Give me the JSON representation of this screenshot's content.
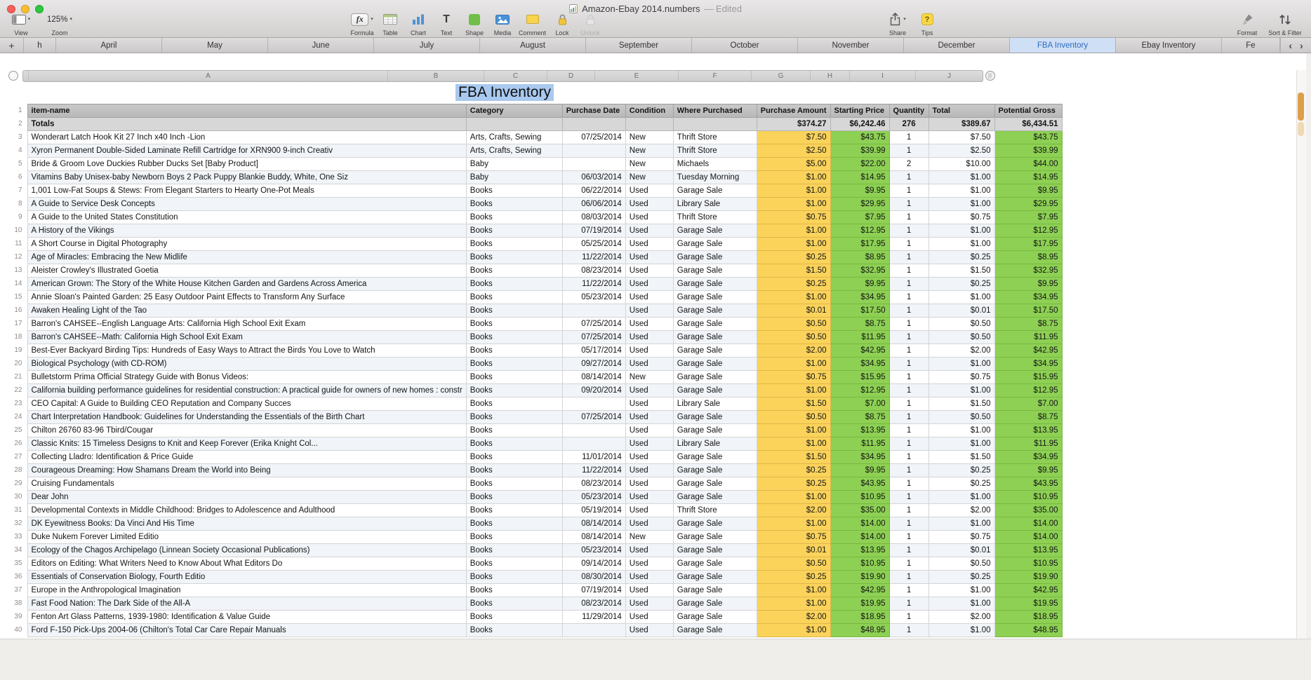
{
  "window": {
    "title": "Amazon-Ebay 2014.numbers",
    "title_suffix": " — Edited"
  },
  "toolbar": {
    "view": "View",
    "zoom": "Zoom",
    "zoom_value": "125%",
    "formula": "Formula",
    "table": "Table",
    "chart": "Chart",
    "text": "Text",
    "shape": "Shape",
    "media": "Media",
    "comment": "Comment",
    "lock": "Lock",
    "unlock": "Unlock",
    "share": "Share",
    "tips": "Tips",
    "format": "Format",
    "sort_filter": "Sort & Filter"
  },
  "tab_bar": {
    "add_tab": "+",
    "prev": "‹",
    "next": "›",
    "tabs": [
      {
        "label": "h",
        "selected": false,
        "partial": true
      },
      {
        "label": "April",
        "selected": false
      },
      {
        "label": "May",
        "selected": false
      },
      {
        "label": "June",
        "selected": false
      },
      {
        "label": "July",
        "selected": false
      },
      {
        "label": "August",
        "selected": false
      },
      {
        "label": "September",
        "selected": false
      },
      {
        "label": "October",
        "selected": false
      },
      {
        "label": "November",
        "selected": false
      },
      {
        "label": "December",
        "selected": false
      },
      {
        "label": "FBA Inventory",
        "selected": true
      },
      {
        "label": "Ebay Inventory",
        "selected": false
      },
      {
        "label": "Fe",
        "selected": false,
        "partial": true
      }
    ]
  },
  "sheet": {
    "title": "FBA Inventory",
    "column_letters": [
      "A",
      "B",
      "C",
      "D",
      "E",
      "F",
      "G",
      "H",
      "I",
      "J"
    ],
    "add_column_glyph": "||",
    "table": {
      "headers": [
        "item-name",
        "Category",
        "Purchase Date",
        "Condition",
        "Where Purchased",
        "Purchase Amount",
        "Starting Price",
        "Quantity",
        "Total",
        "Potential Gross"
      ],
      "totals": [
        "Totals",
        "",
        "",
        "",
        "",
        "$374.27",
        "$6,242.46",
        "276",
        "$389.67",
        "$6,434.51"
      ],
      "rows": [
        [
          "Wonderart Latch Hook Kit 27 Inch x40 Inch -Lion",
          "Arts, Crafts, Sewing",
          "07/25/2014",
          "New",
          "Thrift Store",
          "$7.50",
          "$43.75",
          "1",
          "$7.50",
          "$43.75"
        ],
        [
          "Xyron Permanent Double-Sided Laminate Refill Cartridge for XRN900 9-inch Creativ",
          "Arts, Crafts, Sewing",
          "",
          "New",
          "Thrift Store",
          "$2.50",
          "$39.99",
          "1",
          "$2.50",
          "$39.99"
        ],
        [
          "Bride & Groom Love Duckies Rubber Ducks Set [Baby Product]",
          "Baby",
          "",
          "New",
          "Michaels",
          "$5.00",
          "$22.00",
          "2",
          "$10.00",
          "$44.00"
        ],
        [
          "Vitamins Baby Unisex-baby Newborn Boys 2 Pack Puppy Blankie Buddy, White, One Siz",
          "Baby",
          "06/03/2014",
          "New",
          "Tuesday Morning",
          "$1.00",
          "$14.95",
          "1",
          "$1.00",
          "$14.95"
        ],
        [
          "1,001 Low-Fat Soups & Stews: From Elegant Starters to Hearty One-Pot Meals",
          "Books",
          "06/22/2014",
          "Used",
          "Garage Sale",
          "$1.00",
          "$9.95",
          "1",
          "$1.00",
          "$9.95"
        ],
        [
          "A Guide to Service Desk Concepts",
          "Books",
          "06/06/2014",
          "Used",
          "Library Sale",
          "$1.00",
          "$29.95",
          "1",
          "$1.00",
          "$29.95"
        ],
        [
          "A Guide to the United States Constitution",
          "Books",
          "08/03/2014",
          "Used",
          "Thrift Store",
          "$0.75",
          "$7.95",
          "1",
          "$0.75",
          "$7.95"
        ],
        [
          "A History of the Vikings",
          "Books",
          "07/19/2014",
          "Used",
          "Garage Sale",
          "$1.00",
          "$12.95",
          "1",
          "$1.00",
          "$12.95"
        ],
        [
          "A Short Course in Digital Photography",
          "Books",
          "05/25/2014",
          "Used",
          "Garage Sale",
          "$1.00",
          "$17.95",
          "1",
          "$1.00",
          "$17.95"
        ],
        [
          "Age of Miracles: Embracing the New Midlife",
          "Books",
          "11/22/2014",
          "Used",
          "Garage Sale",
          "$0.25",
          "$8.95",
          "1",
          "$0.25",
          "$8.95"
        ],
        [
          "Aleister Crowley's Illustrated Goetia",
          "Books",
          "08/23/2014",
          "Used",
          "Garage Sale",
          "$1.50",
          "$32.95",
          "1",
          "$1.50",
          "$32.95"
        ],
        [
          "American Grown: The Story of the White House Kitchen Garden and Gardens Across America",
          "Books",
          "11/22/2014",
          "Used",
          "Garage Sale",
          "$0.25",
          "$9.95",
          "1",
          "$0.25",
          "$9.95"
        ],
        [
          "Annie Sloan's Painted Garden: 25 Easy Outdoor Paint Effects to Transform Any Surface",
          "Books",
          "05/23/2014",
          "Used",
          "Garage Sale",
          "$1.00",
          "$34.95",
          "1",
          "$1.00",
          "$34.95"
        ],
        [
          "Awaken Healing Light of the Tao",
          "Books",
          "",
          "Used",
          "Garage Sale",
          "$0.01",
          "$17.50",
          "1",
          "$0.01",
          "$17.50"
        ],
        [
          "Barron's CAHSEE--English Language Arts: California High School Exit Exam",
          "Books",
          "07/25/2014",
          "Used",
          "Garage Sale",
          "$0.50",
          "$8.75",
          "1",
          "$0.50",
          "$8.75"
        ],
        [
          "Barron's CAHSEE--Math: California High School Exit Exam",
          "Books",
          "07/25/2014",
          "Used",
          "Garage Sale",
          "$0.50",
          "$11.95",
          "1",
          "$0.50",
          "$11.95"
        ],
        [
          "Best-Ever Backyard Birding Tips: Hundreds of Easy Ways to Attract the Birds You Love to Watch",
          "Books",
          "05/17/2014",
          "Used",
          "Garage Sale",
          "$2.00",
          "$42.95",
          "1",
          "$2.00",
          "$42.95"
        ],
        [
          "Biological Psychology (with CD-ROM)",
          "Books",
          "09/27/2014",
          "Used",
          "Garage Sale",
          "$1.00",
          "$34.95",
          "1",
          "$1.00",
          "$34.95"
        ],
        [
          "Bulletstorm Prima Official Strategy Guide with Bonus Videos:",
          "Books",
          "08/14/2014",
          "New",
          "Garage Sale",
          "$0.75",
          "$15.95",
          "1",
          "$0.75",
          "$15.95"
        ],
        [
          "California building performance guidelines for residential construction: A practical guide for owners of new homes : constr",
          "Books",
          "09/20/2014",
          "Used",
          "Garage Sale",
          "$1.00",
          "$12.95",
          "1",
          "$1.00",
          "$12.95"
        ],
        [
          "CEO Capital: A Guide to Building CEO Reputation and Company Succes",
          "Books",
          "",
          "Used",
          "Library Sale",
          "$1.50",
          "$7.00",
          "1",
          "$1.50",
          "$7.00"
        ],
        [
          "Chart Interpretation Handbook: Guidelines for Understanding the Essentials of the Birth Chart",
          "Books",
          "07/25/2014",
          "Used",
          "Garage Sale",
          "$0.50",
          "$8.75",
          "1",
          "$0.50",
          "$8.75"
        ],
        [
          "Chilton 26760 83-96 Tbird/Cougar",
          "Books",
          "",
          "Used",
          "Garage Sale",
          "$1.00",
          "$13.95",
          "1",
          "$1.00",
          "$13.95"
        ],
        [
          "Classic Knits: 15 Timeless Designs to Knit and Keep Forever (Erika Knight Col...",
          "Books",
          "",
          "Used",
          "Library Sale",
          "$1.00",
          "$11.95",
          "1",
          "$1.00",
          "$11.95"
        ],
        [
          "Collecting Lladro: Identification & Price Guide",
          "Books",
          "11/01/2014",
          "Used",
          "Garage Sale",
          "$1.50",
          "$34.95",
          "1",
          "$1.50",
          "$34.95"
        ],
        [
          "Courageous Dreaming: How Shamans Dream the World into Being",
          "Books",
          "11/22/2014",
          "Used",
          "Garage Sale",
          "$0.25",
          "$9.95",
          "1",
          "$0.25",
          "$9.95"
        ],
        [
          "Cruising Fundamentals",
          "Books",
          "08/23/2014",
          "Used",
          "Garage Sale",
          "$0.25",
          "$43.95",
          "1",
          "$0.25",
          "$43.95"
        ],
        [
          "Dear John",
          "Books",
          "05/23/2014",
          "Used",
          "Garage Sale",
          "$1.00",
          "$10.95",
          "1",
          "$1.00",
          "$10.95"
        ],
        [
          "Developmental Contexts in Middle Childhood: Bridges to Adolescence and Adulthood",
          "Books",
          "05/19/2014",
          "Used",
          "Thrift Store",
          "$2.00",
          "$35.00",
          "1",
          "$2.00",
          "$35.00"
        ],
        [
          "DK Eyewitness Books: Da Vinci And His Time",
          "Books",
          "08/14/2014",
          "Used",
          "Garage Sale",
          "$1.00",
          "$14.00",
          "1",
          "$1.00",
          "$14.00"
        ],
        [
          "Duke Nukem Forever Limited Editio",
          "Books",
          "08/14/2014",
          "New",
          "Garage Sale",
          "$0.75",
          "$14.00",
          "1",
          "$0.75",
          "$14.00"
        ],
        [
          "Ecology of the Chagos Archipelago (Linnean Society Occasional Publications)",
          "Books",
          "05/23/2014",
          "Used",
          "Garage Sale",
          "$0.01",
          "$13.95",
          "1",
          "$0.01",
          "$13.95"
        ],
        [
          "Editors on Editing: What Writers Need to Know About What Editors Do",
          "Books",
          "09/14/2014",
          "Used",
          "Garage Sale",
          "$0.50",
          "$10.95",
          "1",
          "$0.50",
          "$10.95"
        ],
        [
          "Essentials of Conservation Biology, Fourth Editio",
          "Books",
          "08/30/2014",
          "Used",
          "Garage Sale",
          "$0.25",
          "$19.90",
          "1",
          "$0.25",
          "$19.90"
        ],
        [
          "Europe in the Anthropological Imagination",
          "Books",
          "07/19/2014",
          "Used",
          "Garage Sale",
          "$1.00",
          "$42.95",
          "1",
          "$1.00",
          "$42.95"
        ],
        [
          "Fast Food Nation: The Dark Side of the All-A",
          "Books",
          "08/23/2014",
          "Used",
          "Garage Sale",
          "$1.00",
          "$19.95",
          "1",
          "$1.00",
          "$19.95"
        ],
        [
          "Fenton Art Glass Patterns, 1939-1980: Identification & Value Guide",
          "Books",
          "11/29/2014",
          "Used",
          "Garage Sale",
          "$2.00",
          "$18.95",
          "1",
          "$2.00",
          "$18.95"
        ],
        [
          "Ford F-150 Pick-Ups 2004-06 (Chilton's Total Car Care Repair Manuals",
          "Books",
          "",
          "Used",
          "Garage Sale",
          "$1.00",
          "$48.95",
          "1",
          "$1.00",
          "$48.95"
        ]
      ]
    }
  },
  "colors": {
    "purchase_amount_fill": "#FBD35B",
    "price_fill": "#8DD054",
    "header_row_bg": "#BFBFBF",
    "totals_row_bg": "#D7D7D7",
    "selected_tab_bg": "#CFDFF5",
    "selected_tab_text": "#2E6BC4",
    "title_selection": "#A9C9EF",
    "scroll_marker": "#DD9F4B"
  }
}
